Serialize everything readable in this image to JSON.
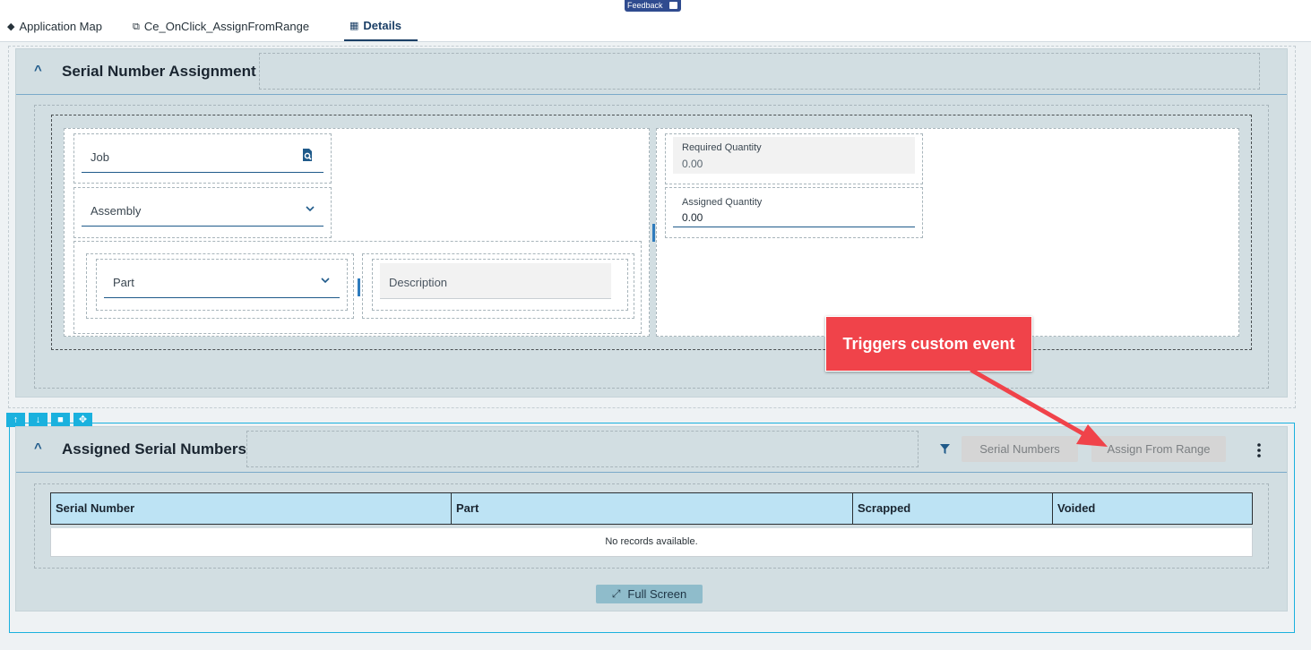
{
  "topbar": {
    "feedback_label": "Feedback",
    "tabs": [
      {
        "label": "Application Map",
        "icon": "layers-icon"
      },
      {
        "label": "Ce_OnClick_AssignFromRange",
        "icon": "diagram-icon"
      },
      {
        "label": "Details",
        "icon": "table-icon"
      }
    ],
    "active_tab": "Details"
  },
  "serial_panel": {
    "title": "Serial Number Assignment",
    "job": {
      "label": "Job",
      "icon": "search-icon"
    },
    "assembly": {
      "label": "Assembly",
      "icon": "chevron-down-icon"
    },
    "part": {
      "label": "Part",
      "icon": "chevron-down-icon"
    },
    "description": {
      "label": "Description"
    },
    "required_quantity": {
      "label": "Required Quantity",
      "value": "0.00"
    },
    "assigned_quantity": {
      "label": "Assigned Quantity",
      "value": "0.00"
    }
  },
  "assigned_panel": {
    "title": "Assigned Serial Numbers",
    "buttons": {
      "serial_numbers": "Serial Numbers",
      "assign_from_range": "Assign From Range",
      "full_screen": "Full Screen"
    },
    "table": {
      "columns": [
        "Serial Number",
        "Part",
        "Scrapped",
        "Voided"
      ],
      "empty_message": "No records available."
    }
  },
  "callout": {
    "text": "Triggers custom event"
  },
  "colors": {
    "accent": "#1f5a8a",
    "panel_bg": "#d2dee2",
    "grid_header": "#bde3f4",
    "callout": "#f0434a",
    "toolbox": "#1ab1de"
  }
}
